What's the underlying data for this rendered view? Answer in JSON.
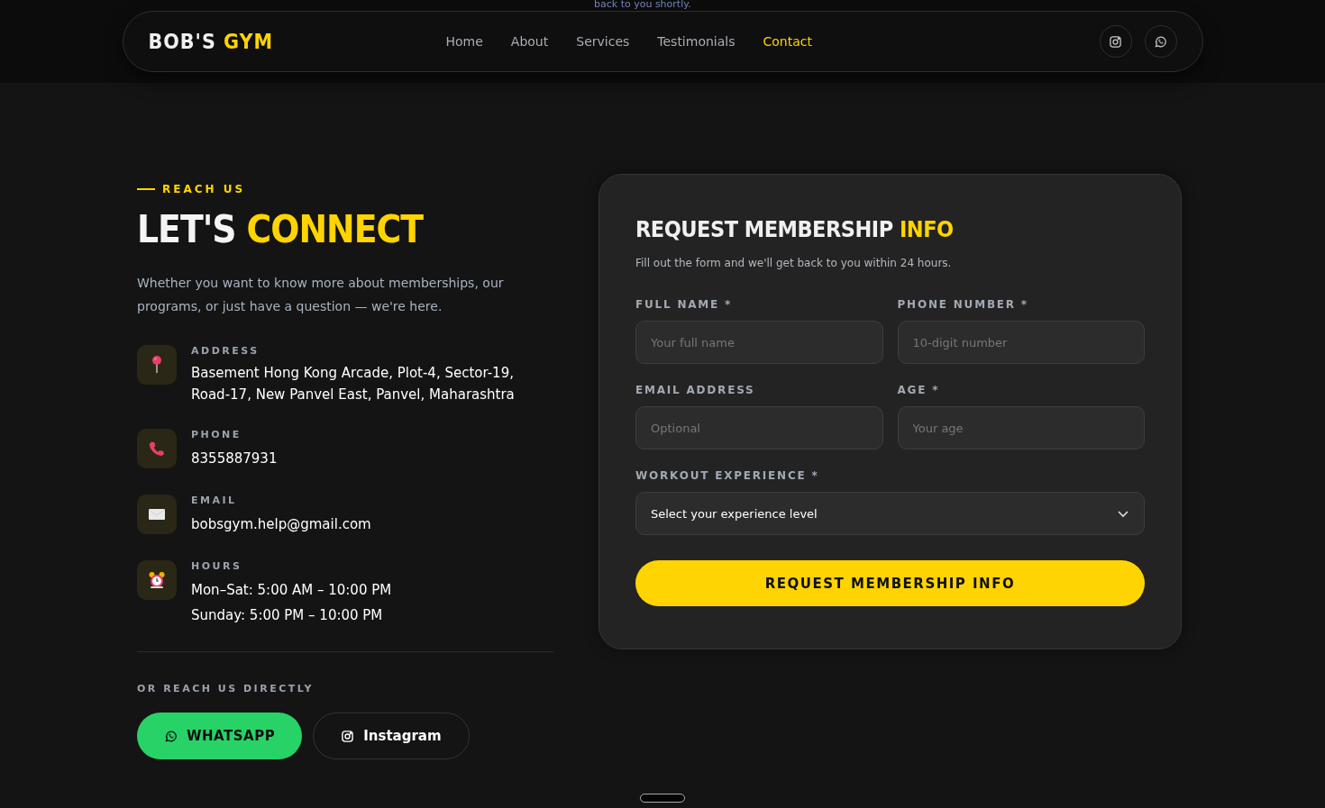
{
  "top_notice": "back to you shortly.",
  "nav": {
    "logo": {
      "text": "BOB'S",
      "highlight": "GYM"
    },
    "links": [
      {
        "label": "Home",
        "selected": false
      },
      {
        "label": "About",
        "selected": false
      },
      {
        "label": "Services",
        "selected": false
      },
      {
        "label": "Testimonials",
        "selected": false
      },
      {
        "label": "Contact",
        "selected": true
      }
    ]
  },
  "contact": {
    "eyebrow": "REACH US",
    "heading": {
      "text": "LET'S",
      "highlight": "CONNECT"
    },
    "intro": "Whether you want to know more about memberships, our programs, or just have a question — we're here.",
    "details": [
      {
        "kind": "address",
        "label": "ADDRESS",
        "lines": [
          "Basement Hong Kong Arcade, Plot-4, Sector-19, Road-17, New Panvel East, Panvel, Maharashtra"
        ]
      },
      {
        "kind": "phone",
        "label": "PHONE",
        "lines": [
          "8355887931"
        ]
      },
      {
        "kind": "email",
        "label": "EMAIL",
        "lines": [
          "bobsgym.help@gmail.com"
        ]
      },
      {
        "kind": "hours",
        "label": "HOURS",
        "lines": [
          "Mon–Sat: 5:00 AM – 10:00 PM",
          "Sunday: 5:00 PM – 10:00 PM"
        ]
      }
    ],
    "direct_label": "OR REACH US DIRECTLY",
    "buttons": [
      {
        "kind": "whatsapp",
        "label": "WHATSAPP"
      },
      {
        "kind": "instagram",
        "label": "Instagram"
      }
    ]
  },
  "form": {
    "title": {
      "text": "REQUEST MEMBERSHIP",
      "highlight": "INFO"
    },
    "subtitle": "Fill out the form and we'll get back to you within 24 hours.",
    "fields": [
      {
        "kind": "input",
        "label": "FULL NAME *",
        "placeholder": "Your full name"
      },
      {
        "kind": "input",
        "label": "PHONE NUMBER *",
        "placeholder": "10-digit number"
      },
      {
        "kind": "input",
        "label": "EMAIL ADDRESS",
        "placeholder": "Optional"
      },
      {
        "kind": "input",
        "label": "AGE *",
        "placeholder": "Your age"
      },
      {
        "kind": "select",
        "label": "WORKOUT EXPERIENCE *",
        "value": "Select your experience level"
      }
    ],
    "submit": "REQUEST MEMBERSHIP INFO"
  }
}
